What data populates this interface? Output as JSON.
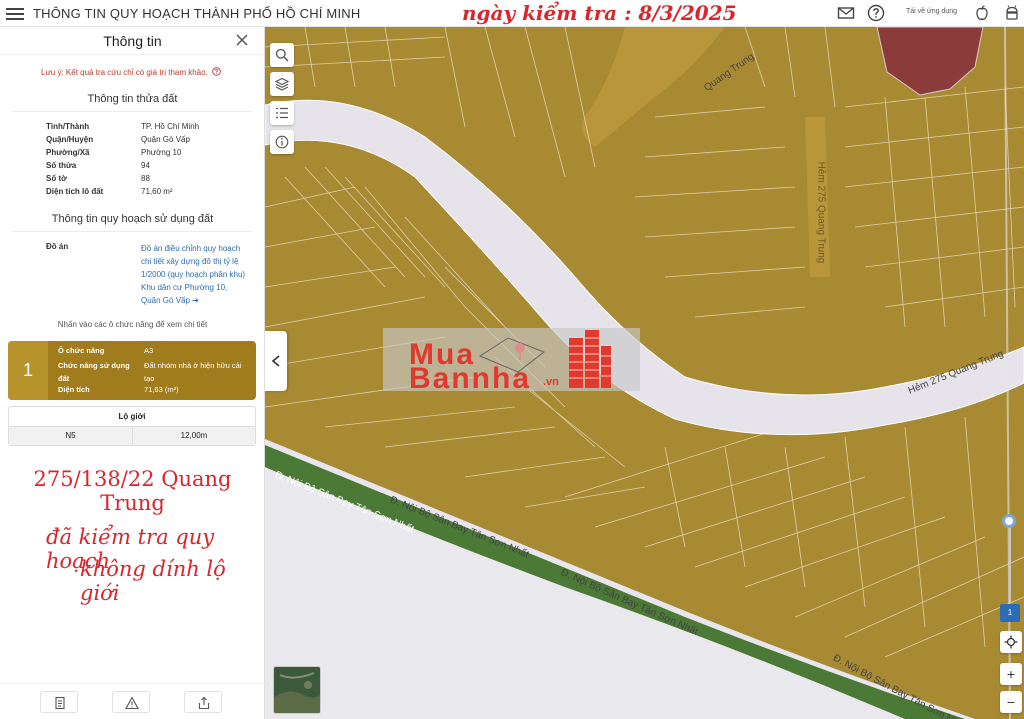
{
  "header": {
    "app_title": "THÔNG TIN QUY HOẠCH THÀNH PHỐ HỒ CHÍ MINH",
    "date_stamp": "ngày kiểm tra : 8/3/2025",
    "app_download": "Tải về ứng dụng",
    "icons": [
      "menu-icon",
      "mail-icon",
      "help-icon",
      "apple-icon",
      "android-icon"
    ]
  },
  "panel": {
    "title": "Thông tin",
    "note": "Lưu ý: Kết quả tra cứu chỉ có giá trị tham khảo.",
    "parcel_section_title": "Thông tin thửa đất",
    "parcel": [
      {
        "label": "Tỉnh/Thành",
        "value": "TP. Hồ Chí Minh"
      },
      {
        "label": "Quận/Huyện",
        "value": "Quận Gò Vấp"
      },
      {
        "label": "Phường/Xã",
        "value": "Phường 10"
      },
      {
        "label": "Số thửa",
        "value": "94"
      },
      {
        "label": "Số tờ",
        "value": "88"
      },
      {
        "label": "Diện tích lô đất",
        "value": "71,60 m²"
      }
    ],
    "planning_section_title": "Thông tin quy hoạch sử dụng đất",
    "doan_label": "Đồ án",
    "doan_value": "Đồ án điều chỉnh quy hoạch chi tiết xây dựng đô thị tỷ lệ 1/2000 (quy hoạch phân khu) Khu dân cư Phường 10, Quận Gò Vấp",
    "hint": "Nhấn vào các ô chức năng để xem chi tiết",
    "zone": {
      "number": "1",
      "rows": [
        {
          "label": "Ô chức năng",
          "value": "A3"
        },
        {
          "label": "Chức năng sử dụng đất",
          "value": "Đất nhóm nhà ở hiện hữu cải tạo"
        },
        {
          "label": "Diện tích",
          "value": "71,63 (m²)"
        }
      ]
    },
    "lo_gioi": {
      "header": "Lộ giới",
      "row": {
        "name": "N5",
        "width": "12,00m"
      }
    },
    "red_note_address": "275/138/22 Quang Trung",
    "red_note_line1": "đã kiểm tra quy hoạch",
    "red_note_line2": "không dính lộ giới"
  },
  "map": {
    "roads": {
      "quang_trung_top": "Quang Trung",
      "hem_vertical": "Hẻm 275 Quang Trung",
      "hem_275": "Hẻm 275 Quang Trung",
      "san_bay_1": "Đ. Nội Bộ Sân Bay Tân Sơn Nhất",
      "san_bay_2": "Đ. Nội Bộ Sân Bay Tân Sơn Nhất",
      "san_bay_3": "Đ. Nội Bộ Sân Bay Tân Sơn Nhất",
      "san_bay_4": "Đ. Nội Bộ Sân Bay Tân Sơn Nhất"
    },
    "watermark_line1": "Mua",
    "watermark_line2": "Bannha",
    "watermark_vn": ".vn",
    "zoom_level": "1",
    "zoom_in": "+",
    "zoom_out": "−",
    "colors": {
      "residential": "#a88a33",
      "road": "#e6e3ea",
      "green": "#4a7a36",
      "red_zone": "#8c3b3b"
    }
  }
}
